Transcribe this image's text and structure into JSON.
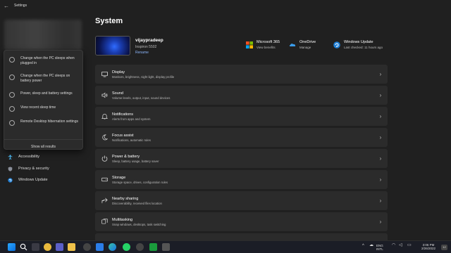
{
  "window": {
    "title": "Settings"
  },
  "search_results": {
    "items": [
      {
        "label": "Change when the PC sleeps when plugged in"
      },
      {
        "label": "Change when the PC sleeps on battery power"
      },
      {
        "label": "Power, sleep and battery settings"
      },
      {
        "label": "View recent sleep time"
      },
      {
        "label": "Remote Desktop hibernation settings"
      }
    ],
    "show_all": "Show all results"
  },
  "sidebar": {
    "items": [
      {
        "label": "Accessibility",
        "icon": "person-icon"
      },
      {
        "label": "Privacy & security",
        "icon": "shield-icon"
      },
      {
        "label": "Windows Update",
        "icon": "update-icon"
      }
    ]
  },
  "main": {
    "title": "System",
    "device": {
      "name": "vijaypradeep",
      "model": "Inspiron 5502",
      "rename": "Rename"
    },
    "quick": [
      {
        "title": "Microsoft 365",
        "sub": "View benefits",
        "icon": "microsoft-icon"
      },
      {
        "title": "OneDrive",
        "sub": "Manage",
        "icon": "onedrive-icon"
      },
      {
        "title": "Windows Update",
        "sub": "Last checked: 11 hours ago",
        "icon": "windows-update-icon"
      }
    ],
    "cards": [
      {
        "title": "Display",
        "sub": "Monitors, brightness, night light, display profile",
        "icon": "display-icon"
      },
      {
        "title": "Sound",
        "sub": "Volume levels, output, input, sound devices",
        "icon": "sound-icon"
      },
      {
        "title": "Notifications",
        "sub": "Alerts from apps and system",
        "icon": "bell-icon"
      },
      {
        "title": "Focus assist",
        "sub": "Notifications, automatic rules",
        "icon": "moon-icon"
      },
      {
        "title": "Power & battery",
        "sub": "Sleep, battery usage, battery saver",
        "icon": "power-icon"
      },
      {
        "title": "Storage",
        "sub": "Storage space, drives, configuration rules",
        "icon": "storage-icon"
      },
      {
        "title": "Nearby sharing",
        "sub": "Discoverability, received files location",
        "icon": "share-icon"
      },
      {
        "title": "Multitasking",
        "sub": "Snap windows, desktops, task switching",
        "icon": "multitask-icon"
      }
    ]
  },
  "taskbar": {
    "lang": "ENG",
    "region": "INTL",
    "time": "3:06 PM",
    "date": "2/26/2022",
    "badge": "12"
  }
}
